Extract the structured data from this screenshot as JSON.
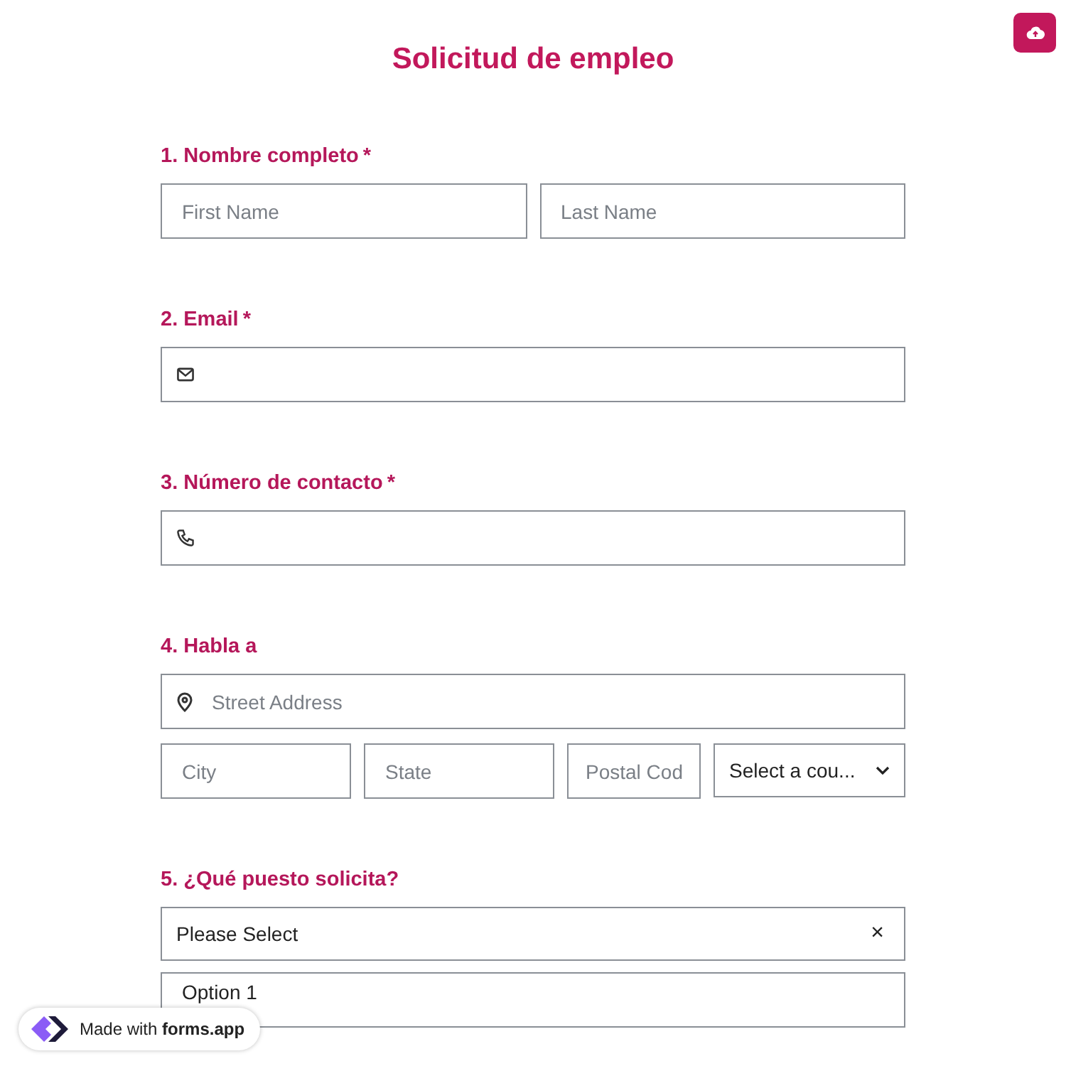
{
  "title": "Solicitud de empleo",
  "questions": [
    {
      "kind": "name",
      "number": "1.",
      "label": "Nombre completo",
      "required_mark": "*",
      "fields": [
        {
          "placeholder": "First Name"
        },
        {
          "placeholder": "Last Name"
        }
      ]
    },
    {
      "kind": "email",
      "number": "2.",
      "label": "Email",
      "required_mark": "*"
    },
    {
      "kind": "phone",
      "number": "3.",
      "label": "Número de contacto",
      "required_mark": "*"
    },
    {
      "kind": "address",
      "number": "4.",
      "label": "Habla a",
      "street": {
        "placeholder": "Street Address"
      },
      "fields": [
        {
          "placeholder": "City"
        },
        {
          "placeholder": "State"
        },
        {
          "placeholder": "Postal Cod"
        }
      ],
      "country": {
        "value": "Select a cou..."
      }
    },
    {
      "kind": "select",
      "number": "5.",
      "label": "¿Qué puesto solicita?",
      "value": "Please Select",
      "clear": "×",
      "options": [
        "Option 1"
      ]
    }
  ],
  "badge": {
    "text": "Made with **forms.app**"
  }
}
